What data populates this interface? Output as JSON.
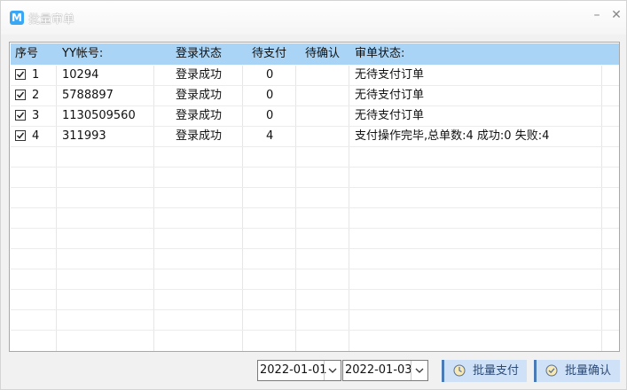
{
  "window": {
    "title": "批量审单",
    "app_icon_letter": "M",
    "minimize_glyph": "–",
    "close_glyph": "✕"
  },
  "table": {
    "headers": [
      "序号",
      "YY帐号:",
      "登录状态",
      "待支付",
      "待确认",
      "审单状态:"
    ],
    "rows": [
      {
        "index": "1",
        "account": "10294",
        "login": "登录成功",
        "pending_pay": "0",
        "pending_confirm": "",
        "status": "无待支付订单",
        "checked": true
      },
      {
        "index": "2",
        "account": "5788897",
        "login": "登录成功",
        "pending_pay": "0",
        "pending_confirm": "",
        "status": "无待支付订单",
        "checked": true
      },
      {
        "index": "3",
        "account": "1130509560",
        "login": "登录成功",
        "pending_pay": "0",
        "pending_confirm": "",
        "status": "无待支付订单",
        "checked": true
      },
      {
        "index": "4",
        "account": "311993",
        "login": "登录成功",
        "pending_pay": "4",
        "pending_confirm": "",
        "status": "支付操作完毕,总单数:4 成功:0 失败:4",
        "checked": true
      }
    ]
  },
  "footer": {
    "date_from": "2022-01-01",
    "date_to": "2022-01-03",
    "pay_button": "批量支付",
    "confirm_button": "批量确认"
  },
  "colors": {
    "header_bg": "#a9d4f5",
    "button_bg": "#cfe1f6",
    "button_accent": "#4a7bb7",
    "app_icon": "#3aa7f5"
  }
}
